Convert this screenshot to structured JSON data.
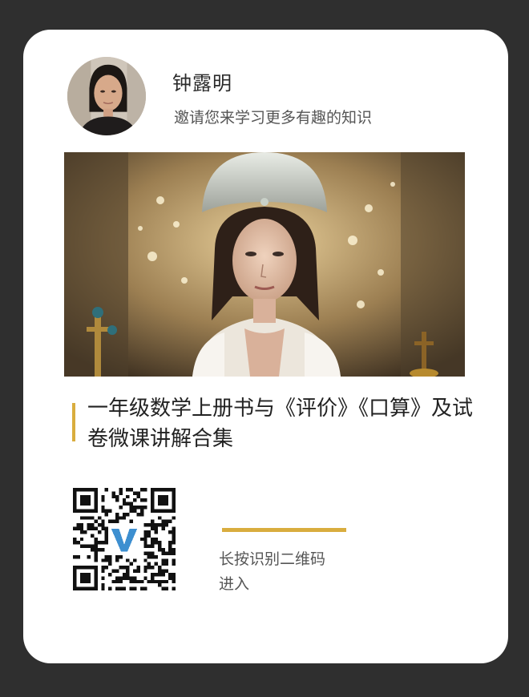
{
  "profile": {
    "name": "钟露明",
    "invite_text": "邀请您来学习更多有趣的知识",
    "avatar_icon": "person-photo-icon"
  },
  "course": {
    "cover_icon": "course-cover-image",
    "title": "一年级数学上册书与《评价》《口算》及试卷微课讲解合集"
  },
  "share": {
    "qr_icon": "qr-code-icon",
    "hint_line1": "长按识别二维码",
    "hint_line2": "进入"
  },
  "colors": {
    "background": "#2f2f2f",
    "card": "#ffffff",
    "accent": "#d9ad3e"
  }
}
